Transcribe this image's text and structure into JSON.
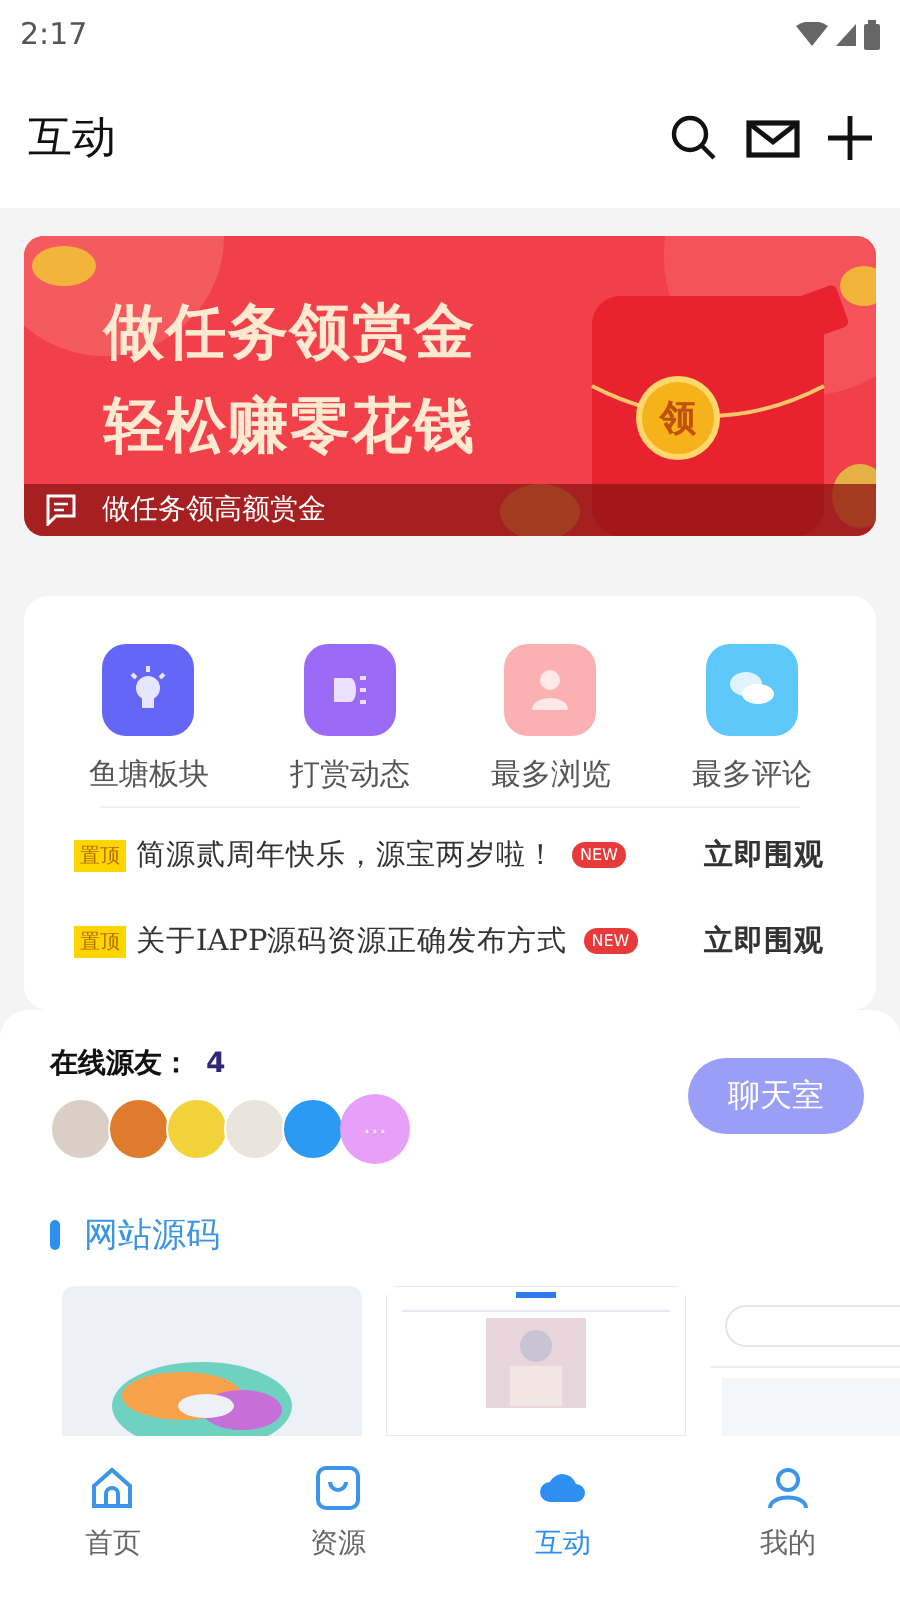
{
  "status_bar": {
    "time": "2:17"
  },
  "header": {
    "title": "互动"
  },
  "banner": {
    "headline": [
      "做任务领赏金",
      "轻松赚零花钱"
    ],
    "badge": "领",
    "caption": "做任务领高额赏金"
  },
  "categories": [
    {
      "label": "鱼塘板块",
      "kind": "bulb",
      "color": "#6366f6"
    },
    {
      "label": "打赏动态",
      "kind": "speaker",
      "color": "#9b6bf7"
    },
    {
      "label": "最多浏览",
      "kind": "person",
      "color": "#fbb1b1"
    },
    {
      "label": "最多评论",
      "kind": "chat",
      "color": "#5ec8fb"
    }
  ],
  "notices": [
    {
      "tag": "置顶",
      "title": "简源贰周年快乐，源宝两岁啦！",
      "badge": "NEW",
      "action": "立即围观"
    },
    {
      "tag": "置顶",
      "title": "关于IAPP源码资源正确发布方式",
      "badge": "NEW",
      "action": "立即围观"
    }
  ],
  "online": {
    "label": "在线源友：",
    "count": "4",
    "more": "···",
    "chat_button": "聊天室"
  },
  "section": {
    "title": "网站源码"
  },
  "bottom_nav": [
    {
      "label": "首页",
      "kind": "home",
      "selected": false
    },
    {
      "label": "资源",
      "kind": "bag",
      "selected": false
    },
    {
      "label": "互动",
      "kind": "cloud",
      "selected": true
    },
    {
      "label": "我的",
      "kind": "user",
      "selected": false
    }
  ]
}
